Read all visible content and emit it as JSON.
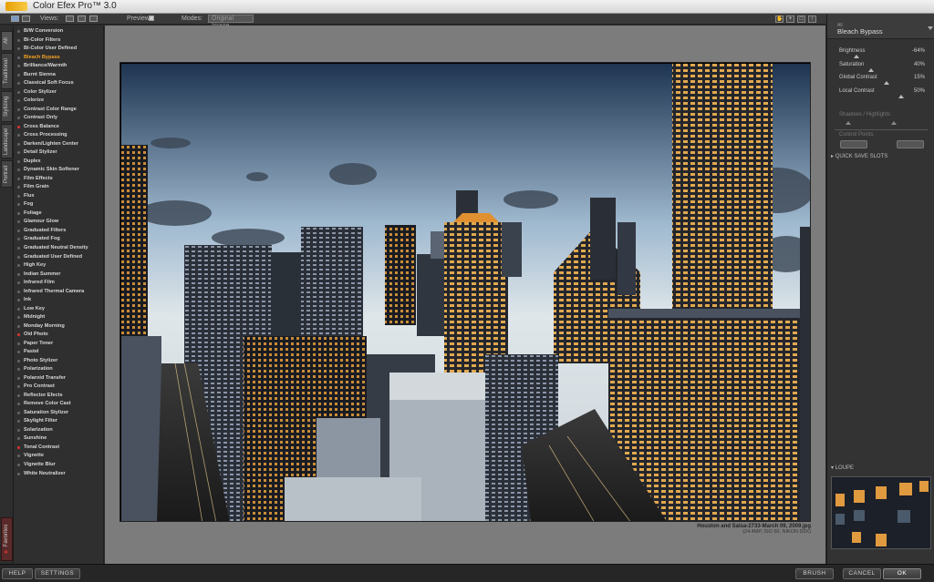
{
  "app": {
    "title": "Color Efex Pro™ 3.0"
  },
  "toolbar": {
    "views_label": "Views:",
    "preview_label": "Preview:",
    "modes_label": "Modes:",
    "modes_value": "Original Image"
  },
  "vtabs": [
    "All",
    "Traditional",
    "Stylizing",
    "Landscape",
    "Portrait",
    "Favorites"
  ],
  "filters": [
    {
      "label": "B/W Conversion",
      "star": false
    },
    {
      "label": "Bi-Color Filters",
      "star": false
    },
    {
      "label": "Bi-Color User Defined",
      "star": false
    },
    {
      "label": "Bleach Bypass",
      "star": false,
      "active": true
    },
    {
      "label": "Brilliance/Warmth",
      "star": false
    },
    {
      "label": "Burnt Sienna",
      "star": false
    },
    {
      "label": "Classical Soft Focus",
      "star": false
    },
    {
      "label": "Color Stylizer",
      "star": false
    },
    {
      "label": "Colorize",
      "star": false
    },
    {
      "label": "Contrast Color Range",
      "star": false
    },
    {
      "label": "Contrast Only",
      "star": false
    },
    {
      "label": "Cross Balance",
      "star": true
    },
    {
      "label": "Cross Processing",
      "star": false
    },
    {
      "label": "Darken/Lighten Center",
      "star": false
    },
    {
      "label": "Detail Stylizer",
      "star": false
    },
    {
      "label": "Duplex",
      "star": false
    },
    {
      "label": "Dynamic Skin Softener",
      "star": false
    },
    {
      "label": "Film Effects",
      "star": false
    },
    {
      "label": "Film Grain",
      "star": false
    },
    {
      "label": "Flux",
      "star": false
    },
    {
      "label": "Fog",
      "star": false
    },
    {
      "label": "Foliage",
      "star": false
    },
    {
      "label": "Glamour Glow",
      "star": false
    },
    {
      "label": "Graduated Filters",
      "star": false
    },
    {
      "label": "Graduated Fog",
      "star": false
    },
    {
      "label": "Graduated Neutral Density",
      "star": false
    },
    {
      "label": "Graduated User Defined",
      "star": false
    },
    {
      "label": "High Key",
      "star": false
    },
    {
      "label": "Indian Summer",
      "star": false
    },
    {
      "label": "Infrared Film",
      "star": false
    },
    {
      "label": "Infrared Thermal Camera",
      "star": false
    },
    {
      "label": "Ink",
      "star": false
    },
    {
      "label": "Low Key",
      "star": false
    },
    {
      "label": "Midnight",
      "star": false
    },
    {
      "label": "Monday Morning",
      "star": false
    },
    {
      "label": "Old Photo",
      "star": true
    },
    {
      "label": "Paper Toner",
      "star": false
    },
    {
      "label": "Pastel",
      "star": false
    },
    {
      "label": "Photo Stylizer",
      "star": false
    },
    {
      "label": "Polarization",
      "star": false
    },
    {
      "label": "Polaroid Transfer",
      "star": false
    },
    {
      "label": "Pro Contrast",
      "star": false
    },
    {
      "label": "Reflector Efects",
      "star": false
    },
    {
      "label": "Remove Color Cast",
      "star": false
    },
    {
      "label": "Saturation Stylizer",
      "star": false
    },
    {
      "label": "Skylight Filter",
      "star": false
    },
    {
      "label": "Solarization",
      "star": false
    },
    {
      "label": "Sunshine",
      "star": false
    },
    {
      "label": "Tonal Contrast",
      "star": true
    },
    {
      "label": "Vignette",
      "star": false
    },
    {
      "label": "Vignette Blur",
      "star": false
    },
    {
      "label": "White Neutralizer",
      "star": false
    }
  ],
  "image": {
    "caption": "Houston and Salsa-2733-March 09, 2009.jpg",
    "meta": "(24.4MP, ISO 50, NIKON D3X)"
  },
  "panel": {
    "category": "All",
    "filter_name": "Bleach Bypass",
    "sliders": [
      {
        "label": "Brightness",
        "value": "-64%",
        "level": 0.18
      },
      {
        "label": "Saturation",
        "value": "40%",
        "level": 0.35
      },
      {
        "label": "Global Contrast",
        "value": "15%",
        "level": 0.53
      },
      {
        "label": "Local Contrast",
        "value": "50%",
        "level": 0.7
      }
    ],
    "shadows_highlights": "Shadows / Highlights",
    "control_points": "Control Points",
    "quick_save": "QUICK SAVE SLOTS",
    "loupe": "LOUPE"
  },
  "bottom": {
    "help": "HELP",
    "settings": "SETTINGS",
    "brush": "BRUSH",
    "cancel": "CANCEL",
    "ok": "OK"
  }
}
